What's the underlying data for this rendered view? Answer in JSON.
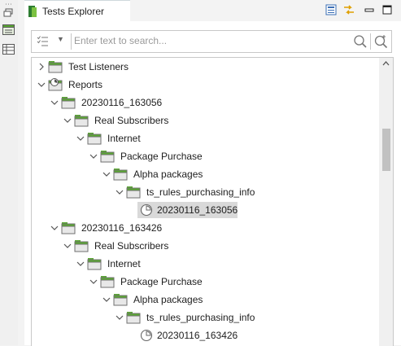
{
  "rail": {
    "icons": [
      "restore-icon",
      "tests-explorer-view-icon",
      "table-view-icon"
    ]
  },
  "panel": {
    "title": "Tests Explorer",
    "toolbar_icons": [
      "collapse-all-icon",
      "link-with-editor-icon",
      "minimize-icon",
      "maximize-icon"
    ]
  },
  "filter": {
    "placeholder": "Enter text to search..."
  },
  "tree": {
    "test_listeners": "Test Listeners",
    "reports": "Reports",
    "report_1": {
      "name": "20230116_163056",
      "real_subscribers": "Real Subscribers",
      "internet": "Internet",
      "package_purchase": "Package Purchase",
      "alpha_packages": "Alpha packages",
      "suite": "ts_rules_purchasing_info",
      "run": "20230116_163056"
    },
    "report_2": {
      "name": "20230116_163426",
      "real_subscribers": "Real Subscribers",
      "internet": "Internet",
      "package_purchase": "Package Purchase",
      "alpha_packages": "Alpha packages",
      "suite": "ts_rules_purchasing_info",
      "run": "20230116_163426"
    }
  },
  "colors": {
    "folder_green": "#5aa832",
    "folder_body": "#e8e8e8",
    "selection": "#d9d9d9"
  }
}
